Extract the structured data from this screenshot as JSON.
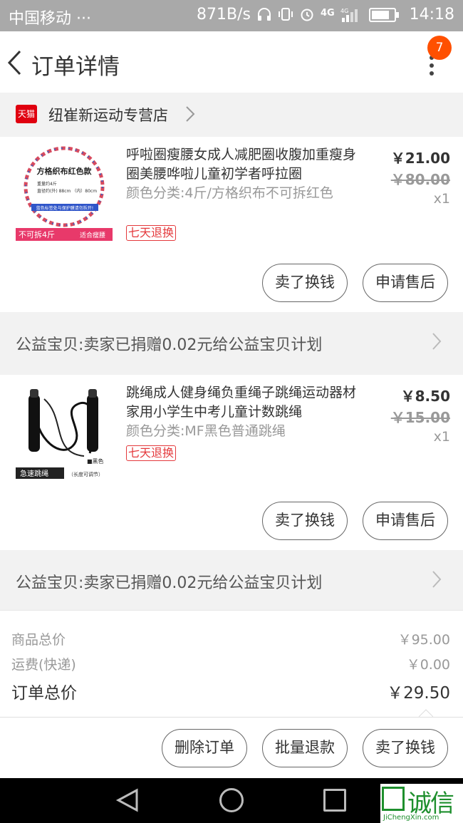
{
  "status_bar": {
    "carrier": "中国移动 ···",
    "speed": "871B/s",
    "time": "14:18",
    "icons": [
      "headset-icon",
      "vibrate-icon",
      "alarm-icon",
      "signal-4g-icon",
      "battery-icon"
    ]
  },
  "header": {
    "title": "订单详情",
    "badge_count": "7"
  },
  "store": {
    "tmall_label": "天猫",
    "name": "纽崔新运动专营店"
  },
  "items": [
    {
      "name": "呼啦圈瘦腰女成人减肥圈收腹加重瘦身圈美腰哗啦儿童初学者呼拉圈",
      "spec": "颜色分类:4斤/方格织布不可拆红色",
      "tag": "七天退换",
      "price": "￥21.00",
      "original_price": "￥80.00",
      "qty": "x1",
      "thumb_title": "方格织布红色款",
      "thumb_line1": "重量约4斤",
      "thumb_line2": "直径约(外) 88cm （内）80cm",
      "thumb_strip": "蓝色标签处与保护膜请勿拆开!",
      "thumb_left": "不可拆4斤",
      "thumb_right": "适合瘦腰",
      "btn_sell": "卖了换钱",
      "btn_aftersale": "申请售后"
    },
    {
      "name": "跳绳成人健身绳负重绳子跳绳运动器材家用小学生中考儿童计数跳绳",
      "spec": "颜色分类:MF黑色普通跳绳",
      "tag": "七天退换",
      "price": "￥8.50",
      "original_price": "￥15.00",
      "qty": "x1",
      "thumb_black": "■黑色",
      "thumb_left": "急速跳绳",
      "thumb_right": "（长度可调节）",
      "btn_sell": "卖了换钱",
      "btn_aftersale": "申请售后"
    }
  ],
  "charity_text": "公益宝贝:卖家已捐赠0.02元给公益宝贝计划",
  "summary": {
    "goods_label": "商品总价",
    "goods_value": "￥95.00",
    "shipping_label": "运费(快递)",
    "shipping_value": "￥0.00",
    "total_label": "订单总价",
    "total_value": "￥29.50"
  },
  "actions": {
    "delete": "删除订单",
    "batch_refund": "批量退款",
    "sell": "卖了换钱"
  },
  "watermark": {
    "text": "诚信",
    "sub": "JiChengXin.com"
  }
}
